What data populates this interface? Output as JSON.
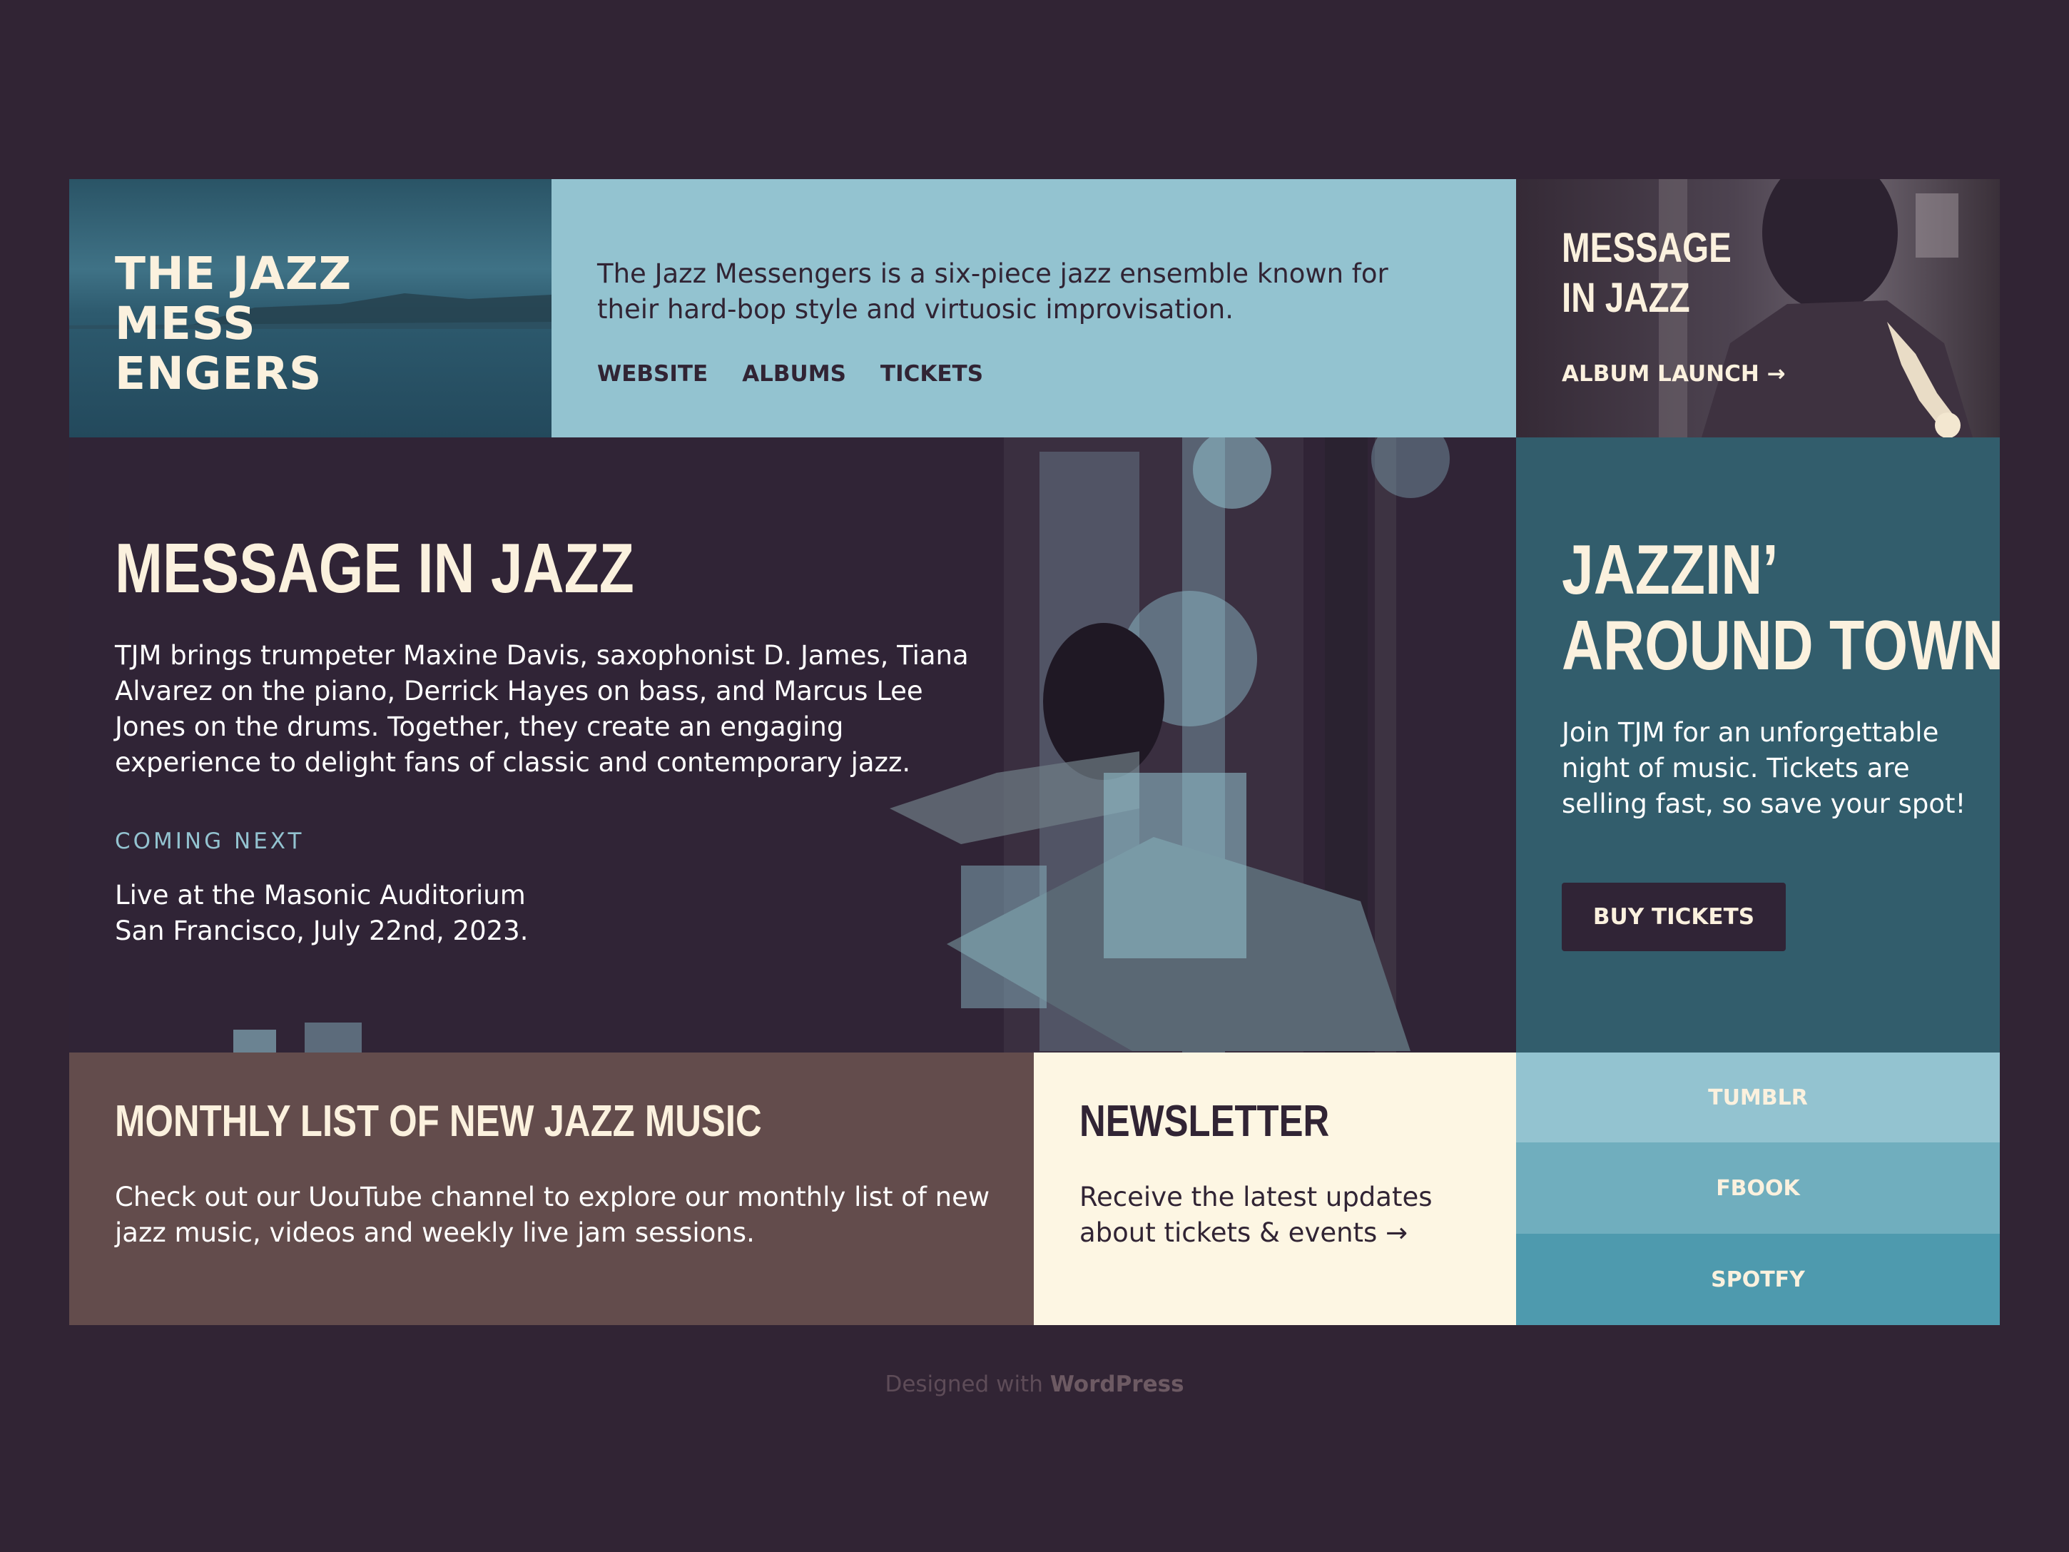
{
  "brand": {
    "title": "THE JAZZ\nMESS\nENGERS"
  },
  "intro": {
    "text": "The Jazz Messengers is a six-piece jazz ensemble known for their hard-bop style and virtuosic improvisation.",
    "nav": [
      "WEBSITE",
      "ALBUMS",
      "TICKETS"
    ]
  },
  "album": {
    "title": "MESSAGE\nIN JAZZ",
    "link": "ALBUM LAUNCH →"
  },
  "feature": {
    "title": "MESSAGE IN JAZZ",
    "text": "TJM brings trumpeter Maxine Davis, saxophonist D. James, Tiana Alvarez on the piano, Derrick Hayes on bass, and Marcus Lee Jones on the drums. Together, they create an engaging experience to delight fans of classic and contemporary jazz.",
    "coming_label": "COMING NEXT",
    "event": "Live at the Masonic Auditorium\nSan Francisco, July 22nd, 2023."
  },
  "town": {
    "title": "JAZZIN’ AROUND TOWN",
    "text": "Join TJM for an unforgettable night of music. Tickets are selling fast, so save your spot!",
    "button": "BUY TICKETS"
  },
  "monthly": {
    "title": "MONTHLY LIST OF NEW JAZZ MUSIC",
    "text": "Check out our UouTube channel to explore our monthly list of new jazz music, videos and weekly live jam sessions."
  },
  "newsletter": {
    "title": "NEWSLETTER",
    "text": "Receive the latest updates about tickets & events →"
  },
  "social": [
    "TUMBLR",
    "FBOOK",
    "SPOTFY"
  ],
  "footer": {
    "prefix": "Designed with ",
    "brand": "WordPress"
  },
  "colors": {
    "background": "#312434",
    "light_blue": "#93c3d0",
    "cream": "#fbf1de",
    "teal": "#325d6c",
    "brown": "#634c4c"
  }
}
